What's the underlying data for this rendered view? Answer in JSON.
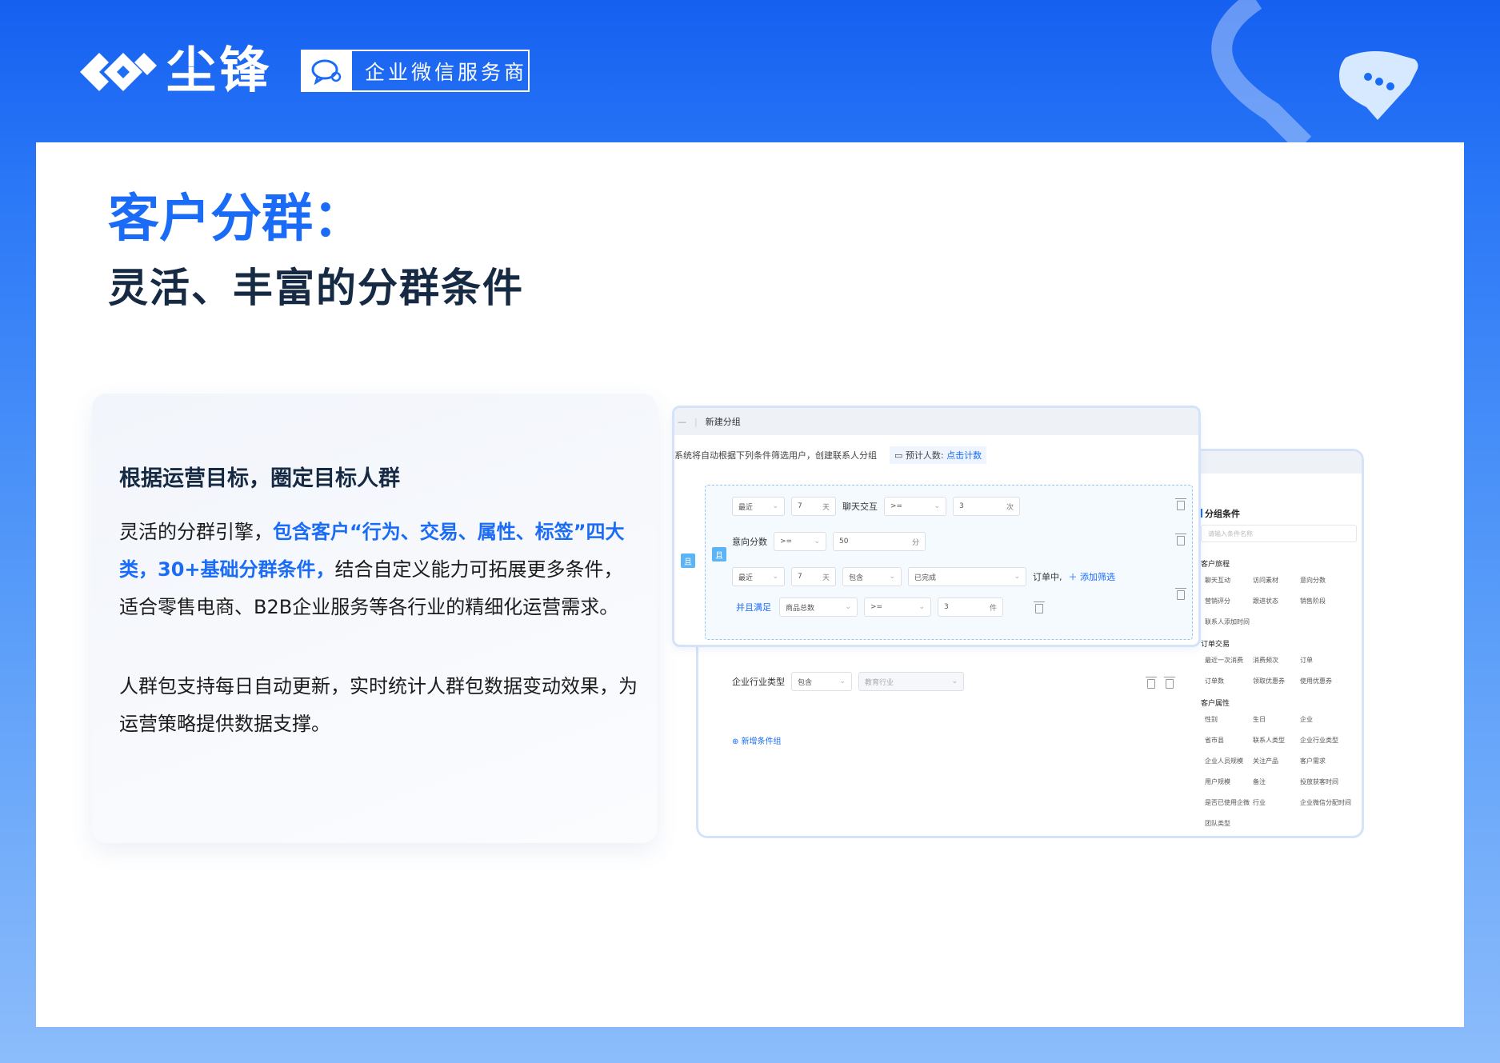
{
  "header": {
    "brand_name": "尘锋",
    "wecom_badge": "企业微信服务商"
  },
  "title": {
    "main": "客户分群：",
    "sub": "灵活、丰富的分群条件"
  },
  "description": {
    "heading": "根据运营目标，圈定目标人群",
    "para1_part1": "灵活的分群引擎，",
    "para1_highlight": "包含客户“行为、交易、属性、标签”四大类，30+基础分群条件，",
    "para1_part2": "结合自定义能力可拓展更多条件，适合零售电商、B2B企业服务等各行业的精细化运营需求。",
    "para2": "人群包支持每日自动更新，实时统计人群包数据变动效果，为运营策略提供数据支撑。"
  },
  "front_panel": {
    "title": "新建分组",
    "desc": "系统将自动根据下列条件筛选用户，创建联系人分组",
    "estimate_label": "预计人数:",
    "estimate_link": "点击计数",
    "and_tag": "且",
    "rows": {
      "r1": {
        "time": "最近",
        "days": "7",
        "days_unit": "天",
        "label": "聊天交互",
        "op": ">=",
        "count": "3",
        "count_unit": "次"
      },
      "r2": {
        "label": "意向分数",
        "op": ">=",
        "score": "50",
        "score_unit": "分"
      },
      "r3": {
        "time": "最近",
        "days": "7",
        "days_unit": "天",
        "contains": "包含",
        "status": "已完成",
        "suffix": "订单中,",
        "add_filter": "添加筛选"
      },
      "r4": {
        "and_satisfy": "并且满足",
        "field": "商品总数",
        "op": ">=",
        "qty": "3",
        "qty_unit": "件"
      }
    }
  },
  "back_panel": {
    "industry_row": {
      "label": "企业行业类型",
      "op": "包含",
      "value": "教育行业"
    },
    "add_group": "新增条件组",
    "side_title": "分组条件",
    "search_placeholder": "请输入条件名称",
    "groups": [
      {
        "name": "客户旅程",
        "items": [
          "聊天互动",
          "访问素材",
          "意向分数",
          "营销评分",
          "跟进状态",
          "销售阶段",
          "联系人添加时间"
        ]
      },
      {
        "name": "订单交易",
        "items": [
          "最近一次消费",
          "消费频次",
          "订单",
          "订单数",
          "领取优惠券",
          "使用优惠券"
        ]
      },
      {
        "name": "客户属性",
        "items": [
          "性别",
          "生日",
          "企业",
          "省市县",
          "联系人类型",
          "企业行业类型",
          "企业人员规模",
          "关注产品",
          "客户需求",
          "用户规模",
          "备注",
          "投放获客时间",
          "是否已使用企微",
          "行业",
          "企业微信分配时间",
          "团队类型"
        ]
      }
    ]
  },
  "colors": {
    "brand_blue": "#1a6cf6",
    "title_dark": "#172a44",
    "tag_blue": "#5bb4f5"
  }
}
